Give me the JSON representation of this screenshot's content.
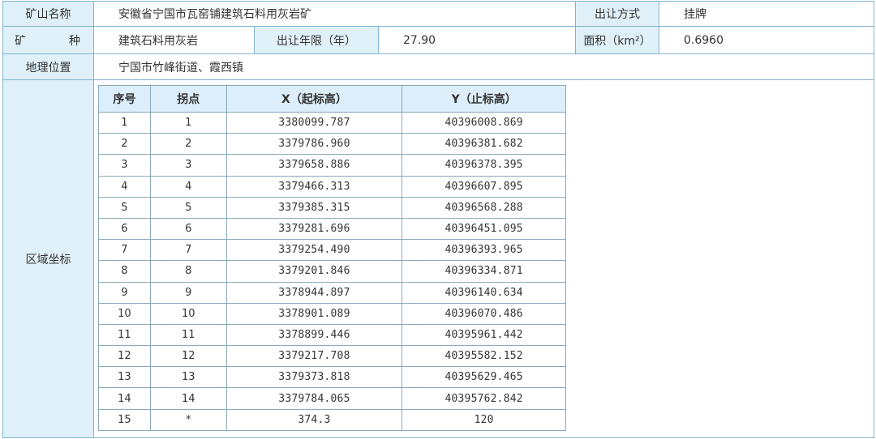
{
  "info": {
    "mine_name_label": "矿山名称",
    "mine_name_value": "安徽省宁国市瓦窑铺建筑石料用灰岩矿",
    "transfer_method_label": "出让方式",
    "transfer_method_value": "挂牌",
    "mineral_label_left": "矿",
    "mineral_label_right": "种",
    "mineral_value": "建筑石料用灰岩",
    "term_label": "出让年限（年）",
    "term_value": "27.90",
    "area_label": "面积（km²）",
    "area_value": "0.6960",
    "location_label": "地理位置",
    "location_value": "宁国市竹峰街道、霞西镇",
    "region_label": "区域坐标"
  },
  "coords": {
    "headers": [
      "序号",
      "拐点",
      "X（起标高）",
      "Y（止标高）"
    ],
    "rows": [
      [
        "1",
        "1",
        "3380099.787",
        "40396008.869"
      ],
      [
        "2",
        "2",
        "3379786.960",
        "40396381.682"
      ],
      [
        "3",
        "3",
        "3379658.886",
        "40396378.395"
      ],
      [
        "4",
        "4",
        "3379466.313",
        "40396607.895"
      ],
      [
        "5",
        "5",
        "3379385.315",
        "40396568.288"
      ],
      [
        "6",
        "6",
        "3379281.696",
        "40396451.095"
      ],
      [
        "7",
        "7",
        "3379254.490",
        "40396393.965"
      ],
      [
        "8",
        "8",
        "3379201.846",
        "40396334.871"
      ],
      [
        "9",
        "9",
        "3378944.897",
        "40396140.634"
      ],
      [
        "10",
        "10",
        "3378901.089",
        "40396070.486"
      ],
      [
        "11",
        "11",
        "3378899.446",
        "40395961.442"
      ],
      [
        "12",
        "12",
        "3379217.708",
        "40395582.152"
      ],
      [
        "13",
        "13",
        "3379373.818",
        "40395629.465"
      ],
      [
        "14",
        "14",
        "3379784.065",
        "40395762.842"
      ],
      [
        "15",
        "*",
        "374.3",
        "120"
      ]
    ]
  }
}
